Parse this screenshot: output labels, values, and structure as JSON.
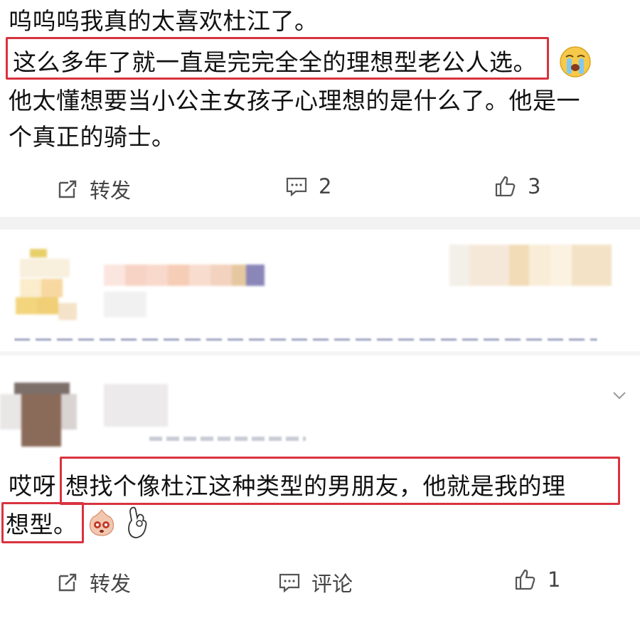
{
  "post1": {
    "line1": "呜呜呜我真的太喜欢杜江了。",
    "line2": "这么多年了就一直是完完全全的理想型老公人选。",
    "line3": "他太懂想要当小公主女孩子心理想的是什么了。他是一",
    "line4": "个真正的骑士。",
    "emoji": "cry-emoji",
    "actions": {
      "repost": "转发",
      "comment": "2",
      "like": "3"
    }
  },
  "post2": {
    "prefix": "哎呀",
    "highlight_line1": "想找个像杜江这种类型的男朋友，他就是我的理",
    "highlight_line2": "想型。",
    "emojis": [
      "crying-emoji",
      "ok-hand-emoji"
    ],
    "actions": {
      "repost": "转发",
      "comment": "评论",
      "like": "1"
    }
  },
  "colors": {
    "highlight": "#d9333f",
    "separator": "#f0f0f0",
    "icon": "#555555"
  }
}
